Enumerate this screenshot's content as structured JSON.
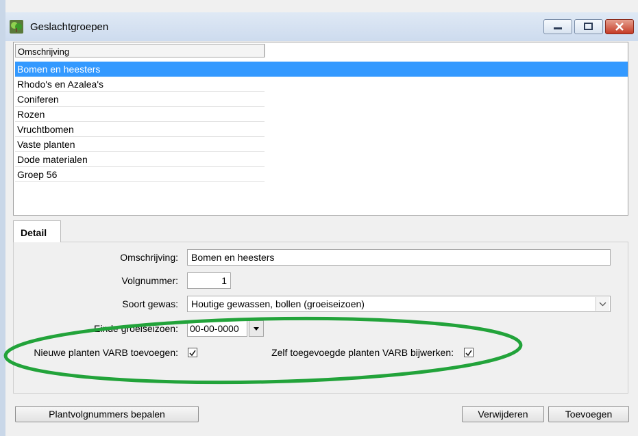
{
  "window": {
    "title": "Geslachtgroepen",
    "icon": "tree-app-icon"
  },
  "list": {
    "column_header": "Omschrijving",
    "rows": [
      {
        "label": "Bomen en heesters",
        "selected": true
      },
      {
        "label": "Rhodo's en Azalea's",
        "selected": false
      },
      {
        "label": "Coniferen",
        "selected": false
      },
      {
        "label": "Rozen",
        "selected": false
      },
      {
        "label": "Vruchtbomen",
        "selected": false
      },
      {
        "label": "Vaste planten",
        "selected": false
      },
      {
        "label": "Dode materialen",
        "selected": false
      },
      {
        "label": "Groep 56",
        "selected": false
      }
    ]
  },
  "detail": {
    "tab_label": "Detail",
    "omschrijving": {
      "label": "Omschrijving:",
      "value": "Bomen en heesters"
    },
    "volgnummer": {
      "label": "Volgnummer:",
      "value": "1"
    },
    "soort_gewas": {
      "label": "Soort gewas:",
      "value": "Houtige gewassen, bollen (groeiseizoen)"
    },
    "einde_groeiseizoen": {
      "label": "Einde groeiseizoen:",
      "value": "00-00-0000"
    },
    "nieuwe_planten": {
      "label": "Nieuwe planten VARB toevoegen:",
      "checked": true
    },
    "zelf_toegevoegde": {
      "label": "Zelf toegevoegde planten VARB bijwerken:",
      "checked": true
    }
  },
  "buttons": {
    "plantvolgnummers": "Plantvolgnummers bepalen",
    "verwijderen": "Verwijderen",
    "toevoegen": "Toevoegen"
  },
  "colors": {
    "selection": "#3399ff",
    "annotation": "#22a33a"
  }
}
